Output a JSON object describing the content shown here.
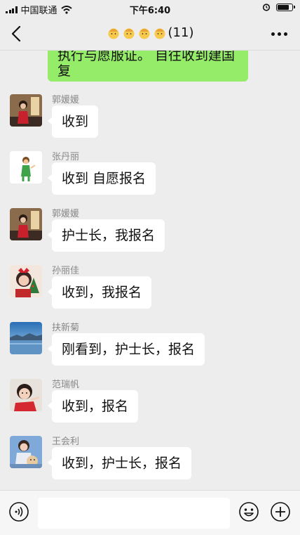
{
  "status_bar": {
    "carrier": "中国联通",
    "time": "下午6:40"
  },
  "header": {
    "title_count": "(11)"
  },
  "top_message": {
    "line1": "执行与愿服证。 自往收到建国",
    "line2": "复"
  },
  "messages": [
    {
      "sender": "郭媛媛",
      "text": "收到"
    },
    {
      "sender": "张丹丽",
      "text": "收到 自愿报名"
    },
    {
      "sender": "郭媛媛",
      "text": "护士长，我报名"
    },
    {
      "sender": "孙丽佳",
      "text": "收到，我报名"
    },
    {
      "sender": "扶新菊",
      "text": "刚看到，护士长，报名"
    },
    {
      "sender": "范瑞帆",
      "text": "收到，报名"
    },
    {
      "sender": "王会利",
      "text": "收到，护士长，报名"
    }
  ],
  "icons": {
    "back": "chevron-left-icon",
    "more": "more-dots-icon",
    "voice": "voice-icon",
    "emoji": "emoji-icon",
    "plus": "plus-icon",
    "wifi": "wifi-icon",
    "signal": "signal-icon",
    "battery": "battery-icon",
    "alarm": "alarm-icon"
  },
  "colors": {
    "background": "#ededed",
    "self_bubble": "#95ec69",
    "other_bubble": "#ffffff",
    "sender_name": "#888888"
  }
}
